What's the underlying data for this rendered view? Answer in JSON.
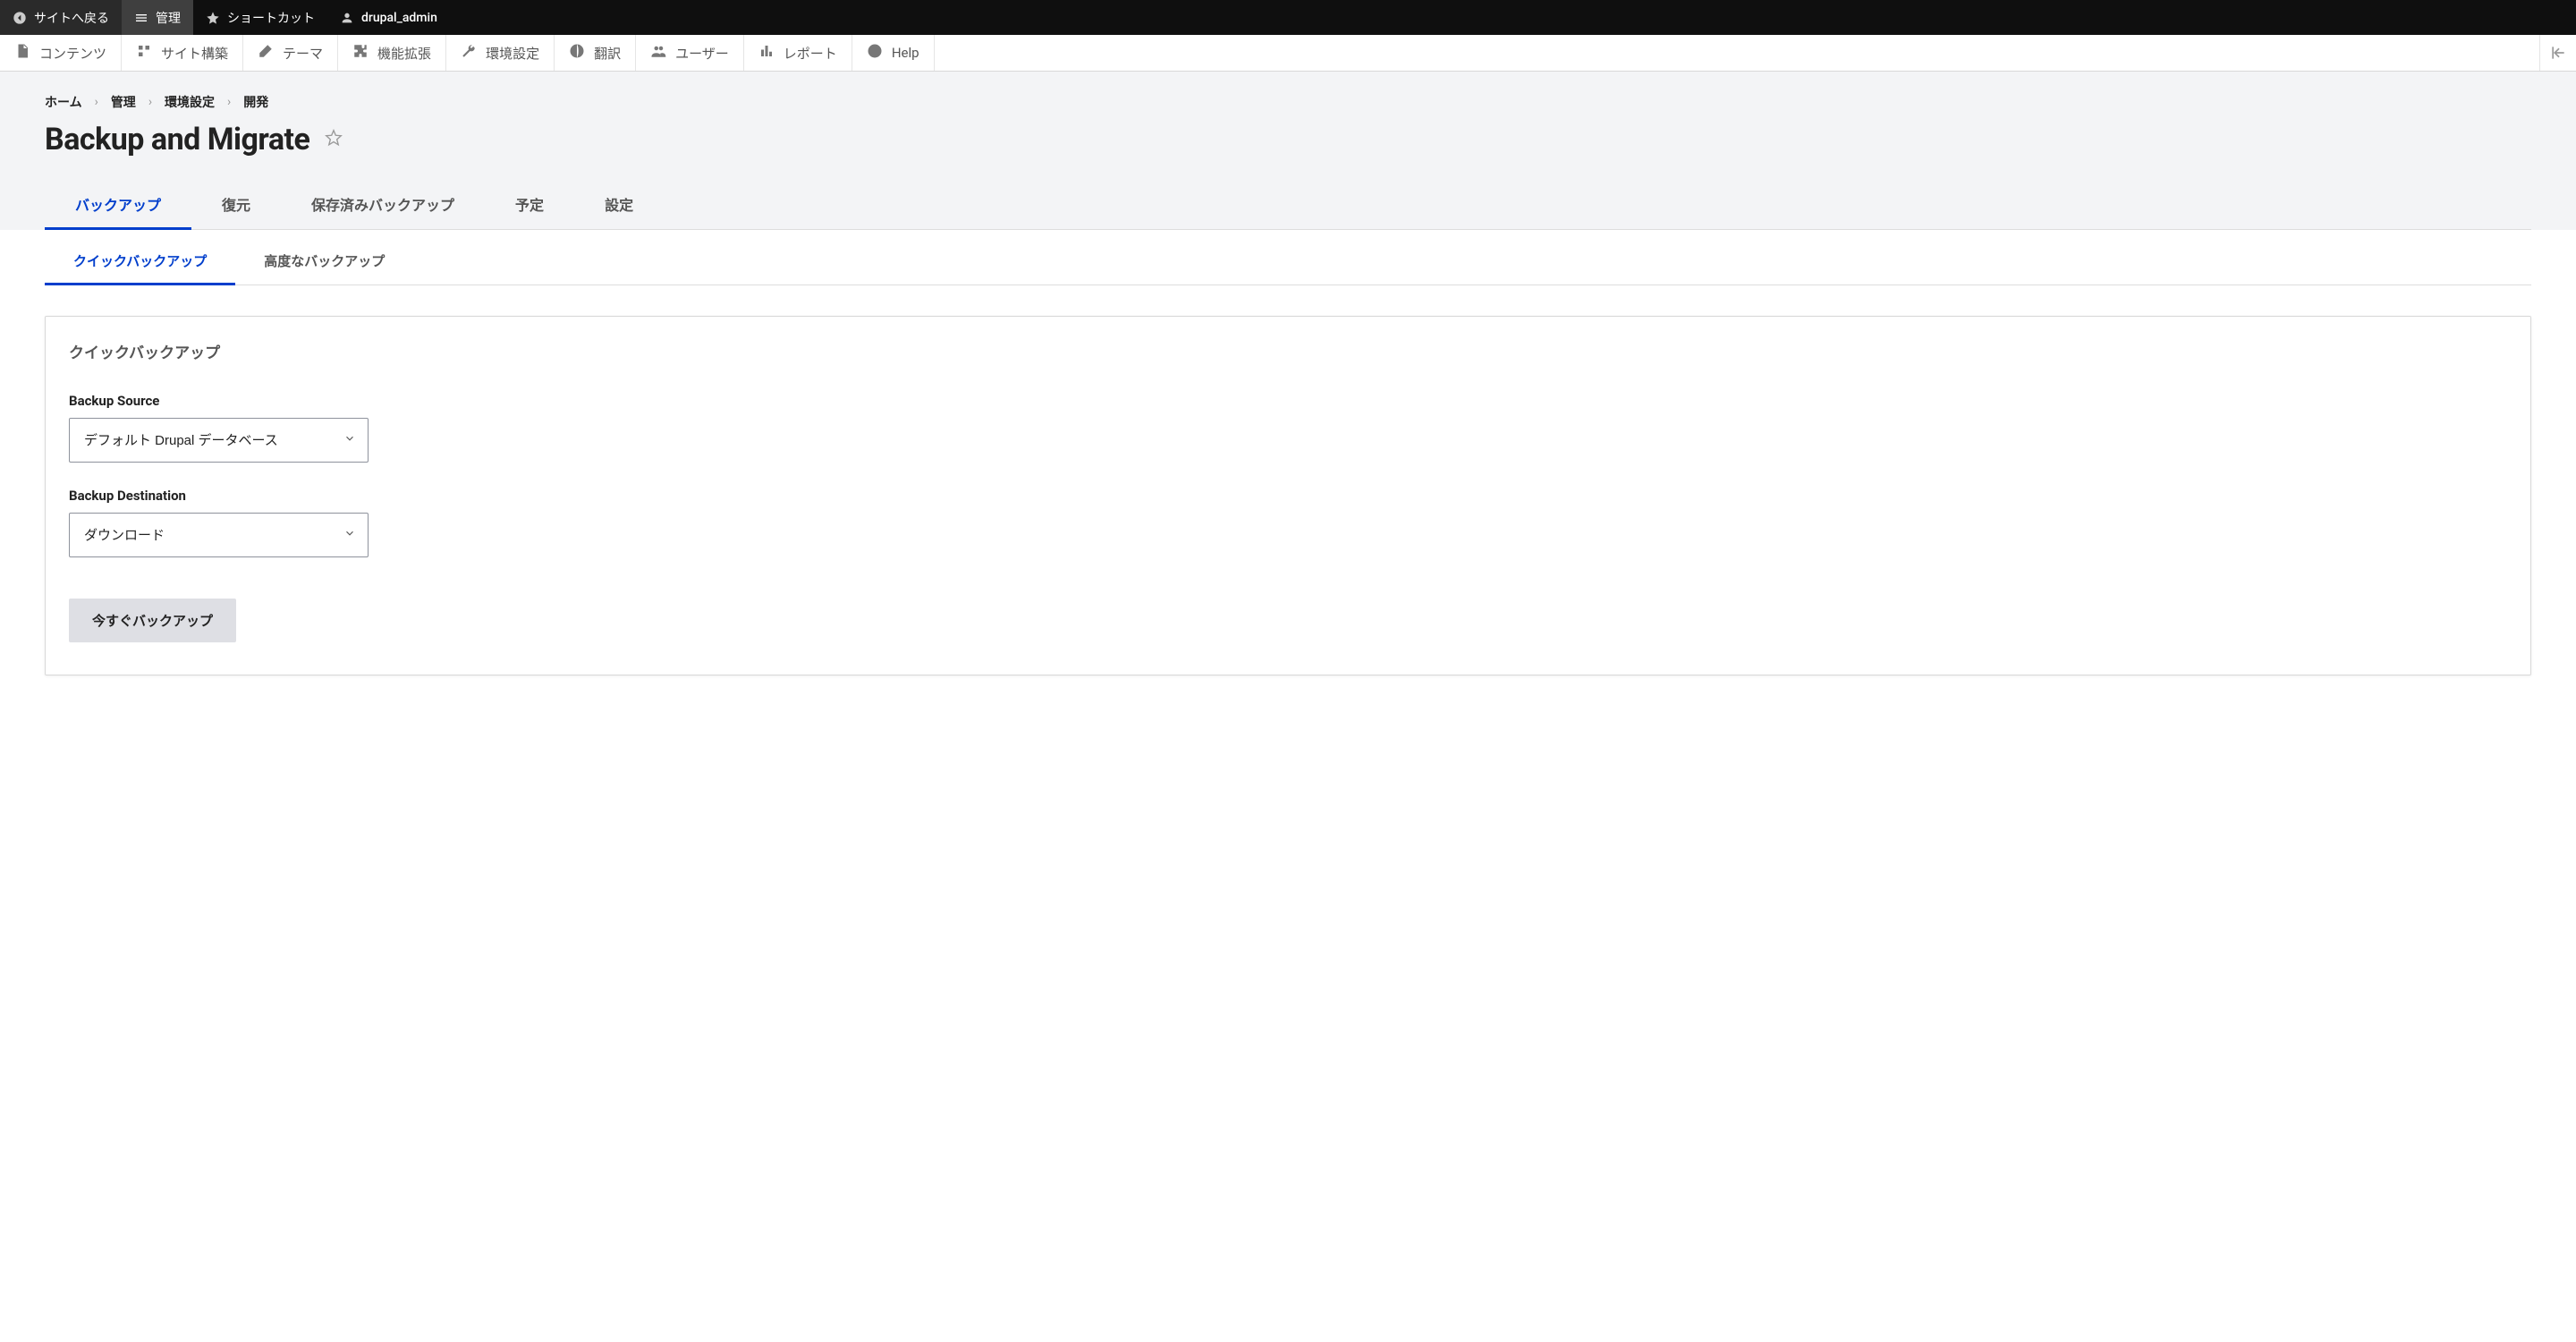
{
  "topbar": {
    "back_to_site": "サイトへ戻る",
    "manage": "管理",
    "shortcuts": "ショートカット",
    "username": "drupal_admin"
  },
  "secondbar": {
    "content": "コンテンツ",
    "structure": "サイト構築",
    "appearance": "テーマ",
    "extend": "機能拡張",
    "configuration": "環境設定",
    "translate": "翻訳",
    "people": "ユーザー",
    "reports": "レポート",
    "help": "Help"
  },
  "breadcrumb": {
    "home": "ホーム",
    "admin": "管理",
    "config": "環境設定",
    "dev": "開発"
  },
  "page": {
    "title": "Backup and Migrate"
  },
  "primary_tabs": {
    "backup": "バックアップ",
    "restore": "復元",
    "saved": "保存済みバックアップ",
    "schedule": "予定",
    "settings": "設定"
  },
  "secondary_tabs": {
    "quick": "クイックバックアップ",
    "advanced": "高度なバックアップ"
  },
  "panel": {
    "title": "クイックバックアップ",
    "source_label": "Backup Source",
    "source_value": "デフォルト Drupal データベース",
    "destination_label": "Backup Destination",
    "destination_value": "ダウンロード",
    "submit": "今すぐバックアップ"
  }
}
